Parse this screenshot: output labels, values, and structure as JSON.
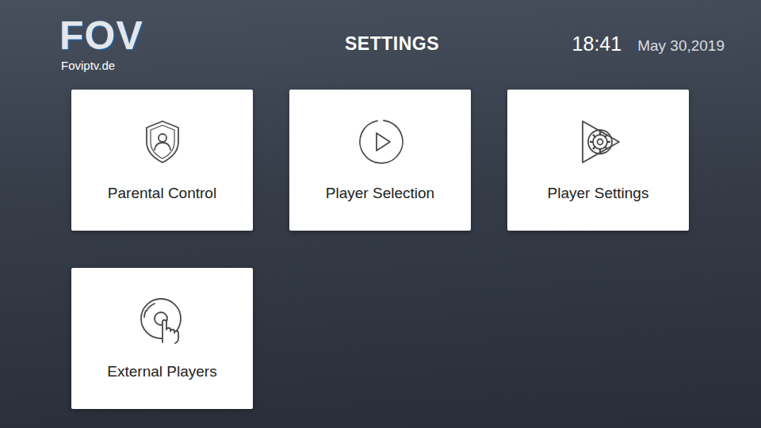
{
  "header": {
    "logo": "FOV",
    "logo_subtitle": "Foviptv.de",
    "title": "SETTINGS",
    "time": "18:41",
    "date": "May 30,2019"
  },
  "tiles": [
    {
      "label": "Parental Control",
      "kind": "shield"
    },
    {
      "label": "Player Selection",
      "kind": "play"
    },
    {
      "label": "Player Settings",
      "kind": "gear"
    },
    {
      "label": "External Players",
      "kind": "disc"
    }
  ]
}
